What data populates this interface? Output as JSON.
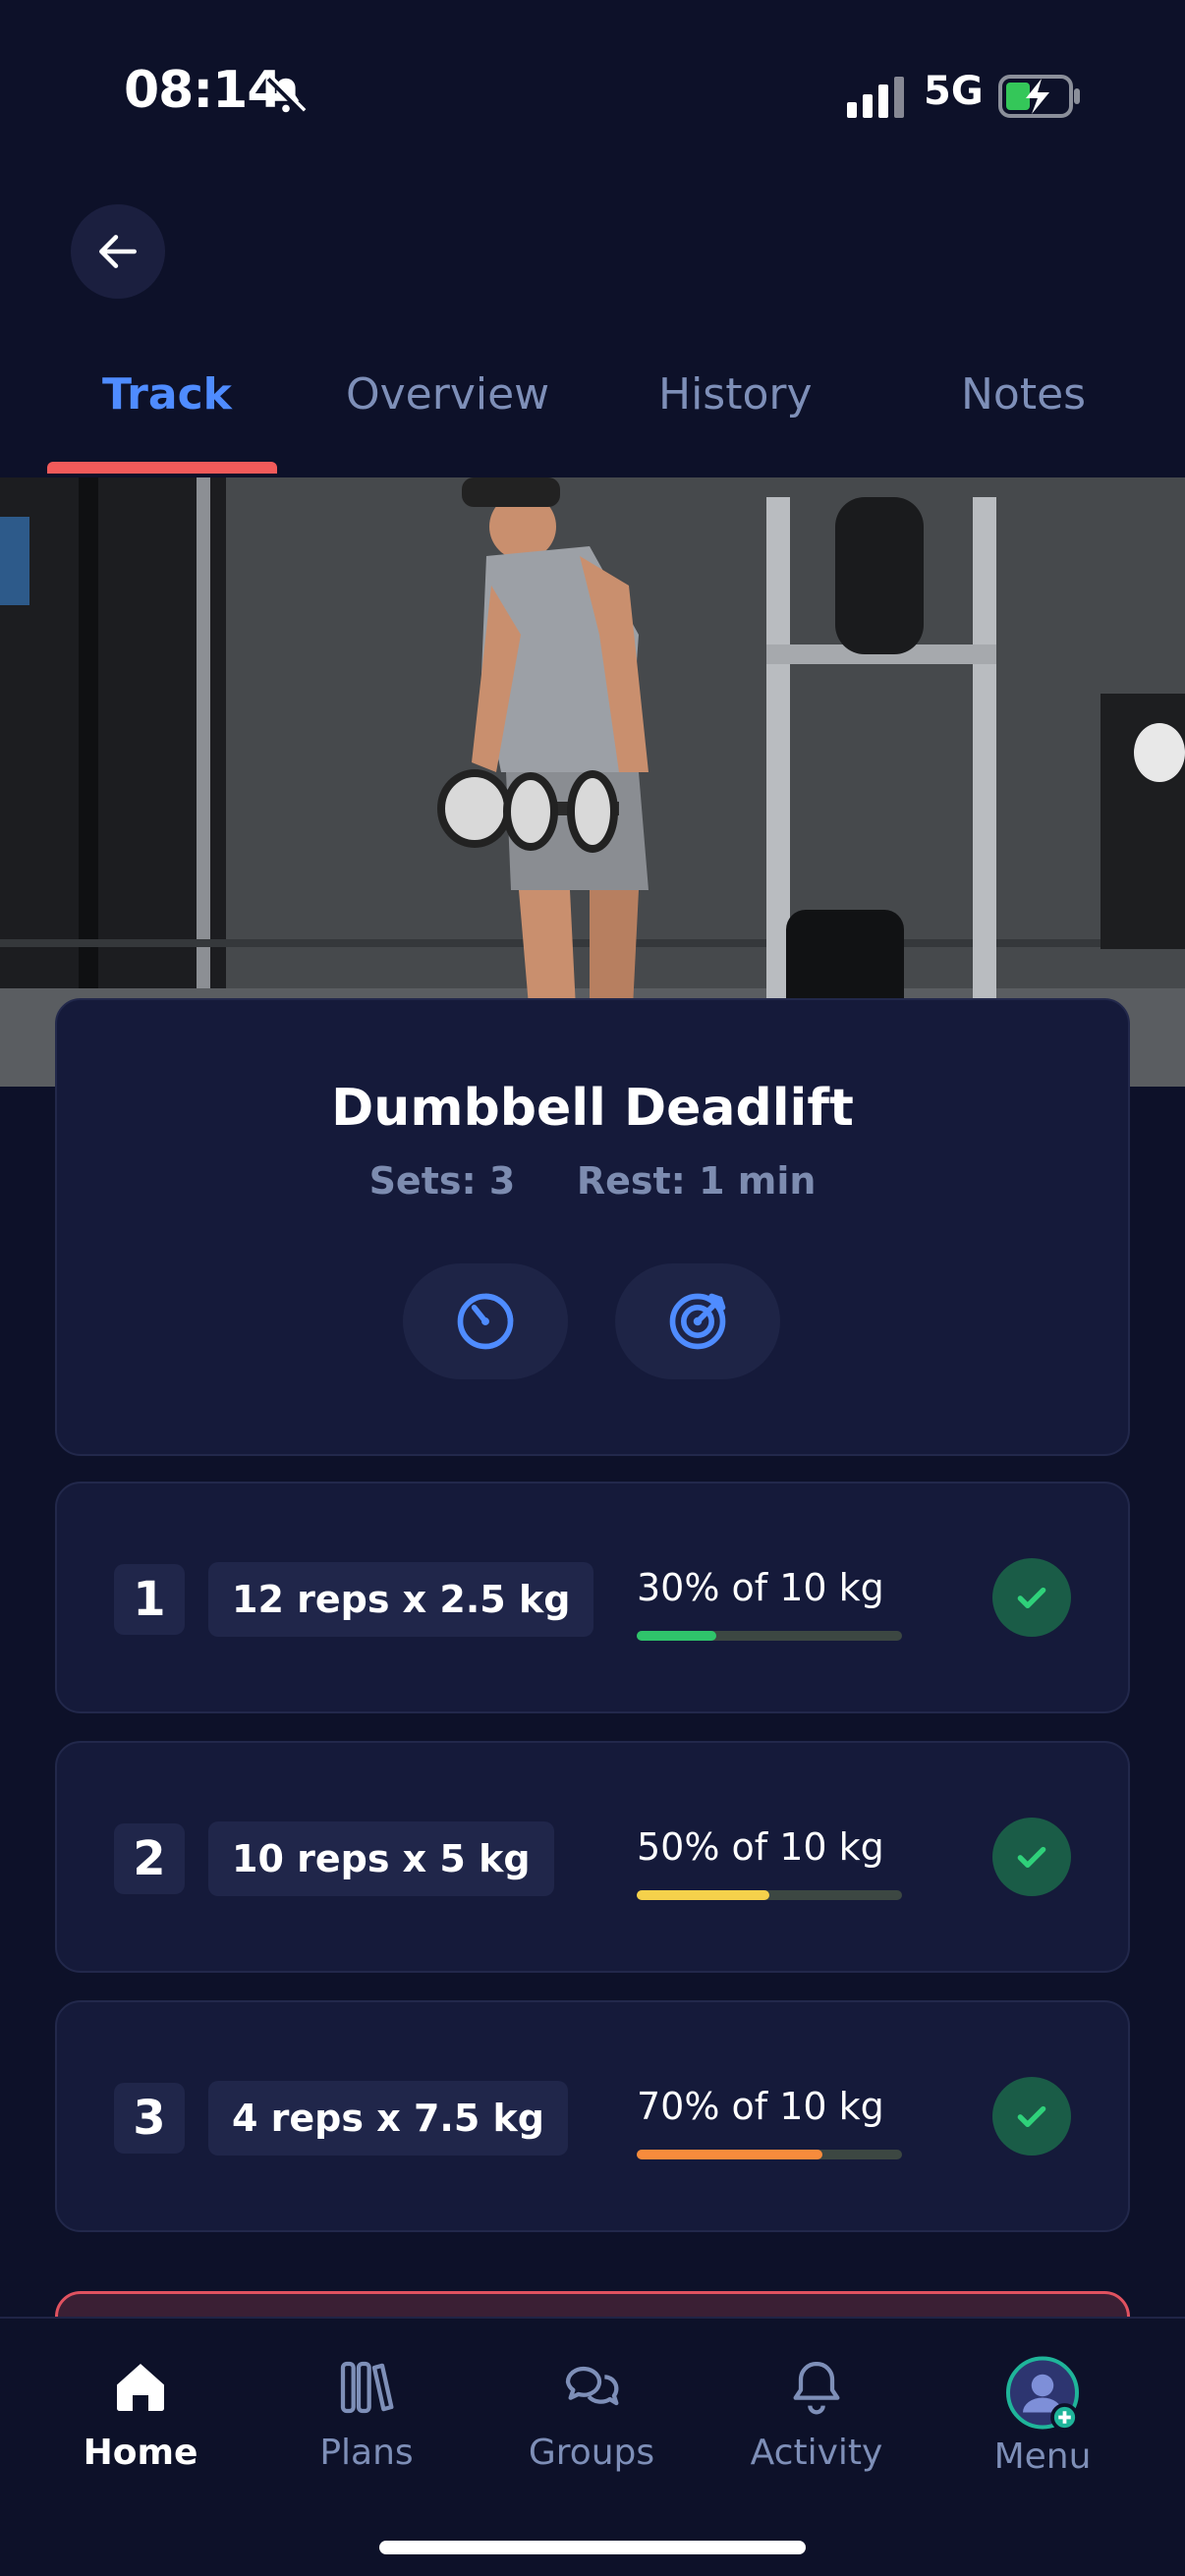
{
  "status": {
    "time": "08:14",
    "network": "5G"
  },
  "tabs": [
    {
      "label": "Track",
      "active": true
    },
    {
      "label": "Overview",
      "active": false
    },
    {
      "label": "History",
      "active": false
    },
    {
      "label": "Notes",
      "active": false
    }
  ],
  "exercise": {
    "title": "Dumbbell Deadlift",
    "sets_label": "Sets: 3",
    "rest_label": "Rest: 1 min"
  },
  "sets": [
    {
      "number": "1",
      "detail": "12 reps x 2.5 kg",
      "percent_text": "30% of 10 kg",
      "progress": 0.3,
      "color": "#2fc46b"
    },
    {
      "number": "2",
      "detail": "10 reps x 5 kg",
      "percent_text": "50% of 10 kg",
      "progress": 0.5,
      "color": "#f5d14b"
    },
    {
      "number": "3",
      "detail": "4 reps x 7.5 kg",
      "percent_text": "70% of 10 kg",
      "progress": 0.7,
      "color": "#f78b3c"
    }
  ],
  "nav": [
    {
      "label": "Home",
      "icon": "home-icon",
      "active": true
    },
    {
      "label": "Plans",
      "icon": "books-icon",
      "active": false
    },
    {
      "label": "Groups",
      "icon": "chat-bubbles-icon",
      "active": false
    },
    {
      "label": "Activity",
      "icon": "bell-icon",
      "active": false
    },
    {
      "label": "Menu",
      "icon": "avatar-icon",
      "active": false
    }
  ],
  "colors": {
    "accent": "#4f8cff",
    "tab_indicator": "#f25a5a",
    "background": "#0d1129",
    "card": "#151a3a"
  }
}
